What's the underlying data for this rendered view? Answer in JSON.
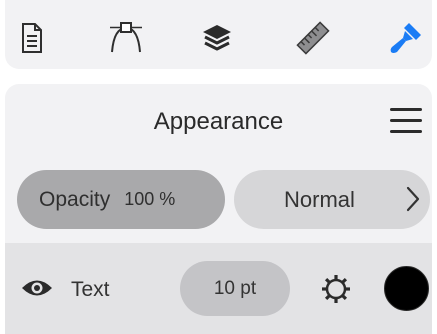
{
  "toolbar": {
    "tools": [
      {
        "name": "document-icon"
      },
      {
        "name": "bezier-pen-icon"
      },
      {
        "name": "layers-icon"
      },
      {
        "name": "ruler-icon"
      },
      {
        "name": "paintbrush-icon",
        "active": true
      }
    ]
  },
  "panel": {
    "title": "Appearance",
    "opacity": {
      "label": "Opacity",
      "value": "100 %"
    },
    "blend_mode": "Normal",
    "layer": {
      "label": "Text",
      "size": "10 pt",
      "visible": true,
      "color": "#000000"
    }
  },
  "colors": {
    "accent": "#1a7cf5",
    "panel_bg": "#f2f2f4",
    "row_bg": "#e3e3e5"
  }
}
